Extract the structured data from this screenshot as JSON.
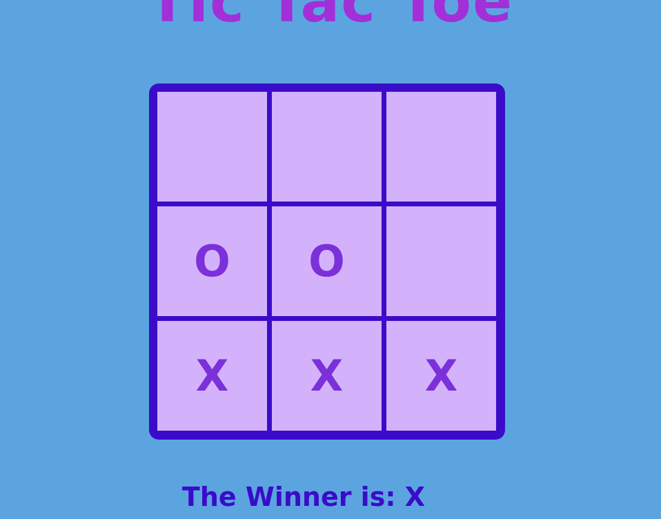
{
  "game": {
    "title": "Tic Tac Toe",
    "board": [
      [
        "",
        "",
        ""
      ],
      [
        "O",
        "O",
        ""
      ],
      [
        "X",
        "X",
        "X"
      ]
    ],
    "status": "The Winner is: X"
  },
  "colors": {
    "background": "#5ca4e0",
    "title": "#a22fd8",
    "board_frame": "#3a0cc9",
    "cell": "#d3b2fb",
    "mark": "#7b30d9",
    "status": "#3a0cc9"
  }
}
